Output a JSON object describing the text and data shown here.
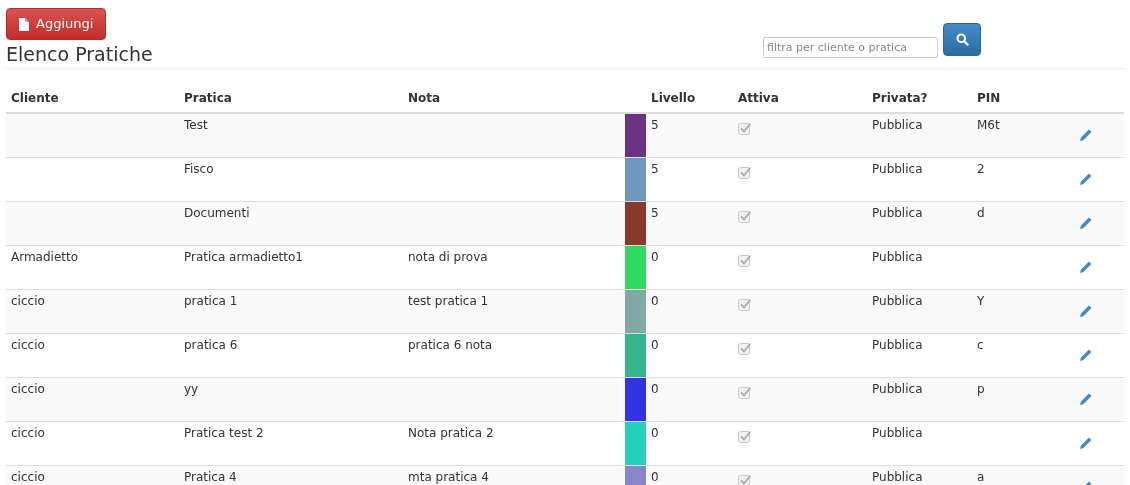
{
  "add_button": {
    "label": "Aggiungi"
  },
  "title": "Elenco Pratiche",
  "search": {
    "placeholder": "filtra per cliente o pratica"
  },
  "table": {
    "columns": [
      "Cliente",
      "Pratica",
      "Nota",
      "Livello",
      "Attiva",
      "Privata?",
      "PIN"
    ],
    "rows": [
      {
        "cliente": "",
        "pratica": "Test",
        "nota": "",
        "color": "#6b3480",
        "livello": "5",
        "attiva": true,
        "disabled": true,
        "privata": "Pubblica",
        "pin": "M6t"
      },
      {
        "cliente": "",
        "pratica": "Fisco",
        "nota": "",
        "color": "#6f98bd",
        "livello": "5",
        "attiva": true,
        "disabled": true,
        "privata": "Pubblica",
        "pin": "2"
      },
      {
        "cliente": "",
        "pratica": "Documenti",
        "nota": "",
        "color": "#8a3a28",
        "livello": "5",
        "attiva": true,
        "disabled": true,
        "privata": "Pubblica",
        "pin": "d"
      },
      {
        "cliente": "Armadietto",
        "pratica": "Pratica armadietto1",
        "nota": "nota di prova",
        "color": "#2fd95f",
        "livello": "0",
        "attiva": true,
        "disabled": true,
        "privata": "Pubblica",
        "pin": ""
      },
      {
        "cliente": "ciccio",
        "pratica": "pratica 1",
        "nota": "test pratica 1",
        "color": "#7fa8a6",
        "livello": "0",
        "attiva": true,
        "disabled": true,
        "privata": "Pubblica",
        "pin": "Y"
      },
      {
        "cliente": "ciccio",
        "pratica": "pratica 6",
        "nota": "pratica 6 nota",
        "color": "#35b38b",
        "livello": "0",
        "attiva": true,
        "disabled": true,
        "privata": "Pubblica",
        "pin": "c"
      },
      {
        "cliente": "ciccio",
        "pratica": "yy",
        "nota": "",
        "color": "#3333e6",
        "livello": "0",
        "attiva": true,
        "disabled": true,
        "privata": "Pubblica",
        "pin": "p"
      },
      {
        "cliente": "ciccio",
        "pratica": "Pratica test 2",
        "nota": "Nota pratica 2",
        "color": "#22d1b8",
        "livello": "0",
        "attiva": true,
        "disabled": true,
        "privata": "Pubblica",
        "pin": ""
      },
      {
        "cliente": "ciccio",
        "pratica": "Pratica 4",
        "nota": "mta pratica 4",
        "color": "#8686c8",
        "livello": "0",
        "attiva": true,
        "disabled": true,
        "privata": "Pubblica",
        "pin": "a"
      }
    ]
  }
}
